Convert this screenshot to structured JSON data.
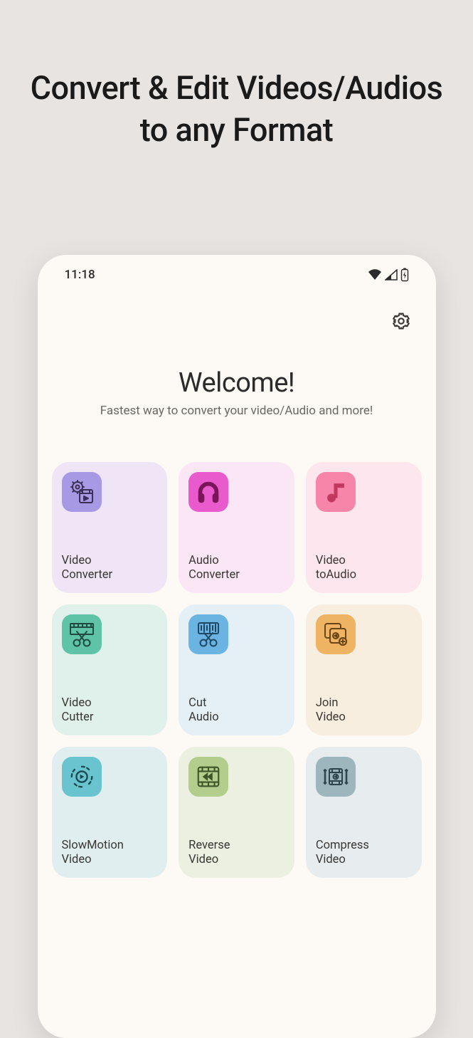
{
  "promo_title": "Convert & Edit Videos/Audios to any Format",
  "status": {
    "time": "11:18"
  },
  "header": {
    "title": "Welcome!",
    "subtitle": "Fastest way to convert your video/Audio and more!"
  },
  "tiles": [
    {
      "label": "Video\nConverter",
      "icon": "video-converter-icon"
    },
    {
      "label": "Audio\nConverter",
      "icon": "audio-converter-icon"
    },
    {
      "label": "Video\ntoAudio",
      "icon": "video-to-audio-icon"
    },
    {
      "label": "Video\nCutter",
      "icon": "video-cutter-icon"
    },
    {
      "label": "Cut\nAudio",
      "icon": "cut-audio-icon"
    },
    {
      "label": "Join\nVideo",
      "icon": "join-video-icon"
    },
    {
      "label": "SlowMotion\nVideo",
      "icon": "slow-motion-icon"
    },
    {
      "label": "Reverse\nVideo",
      "icon": "reverse-video-icon"
    },
    {
      "label": "Compress\nVideo",
      "icon": "compress-video-icon"
    }
  ]
}
